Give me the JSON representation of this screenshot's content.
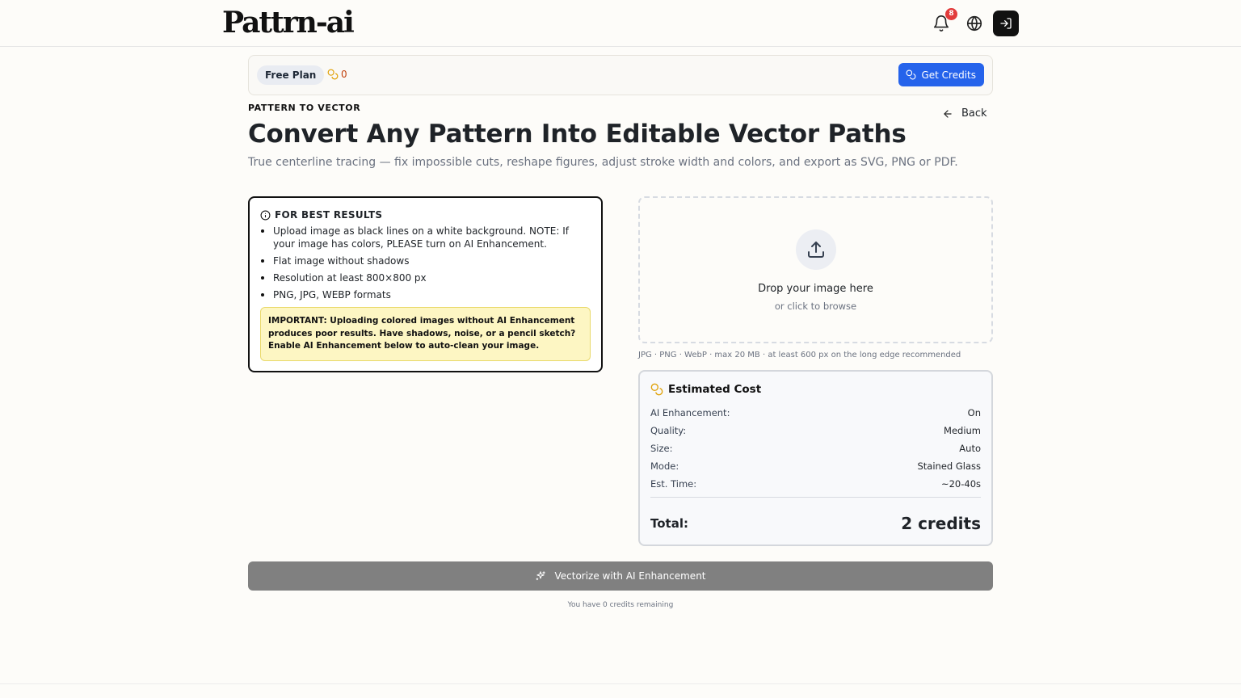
{
  "header": {
    "logo": "Pattrn-ai",
    "notifications_count": "8",
    "icons": [
      "bell-icon",
      "globe-icon",
      "login-icon"
    ]
  },
  "plan_bar": {
    "plan_label": "Free Plan",
    "credits": "0",
    "get_credits_label": "Get Credits"
  },
  "page": {
    "eyebrow": "PATTERN TO VECTOR",
    "back_label": "Back",
    "title": "Convert Any Pattern Into Editable Vector Paths",
    "subtitle": "True centerline tracing — fix impossible cuts, reshape figures, adjust stroke width and colors, and export as SVG, PNG or PDF."
  },
  "tips": {
    "heading": "FOR BEST RESULTS",
    "items": [
      "Upload image as black lines on a white background. NOTE: If your image has colors, PLEASE turn on AI Enhancement.",
      "Flat image without shadows",
      "Resolution at least 800×800 px",
      "PNG, JPG, WEBP formats"
    ],
    "warning": "IMPORTANT: Uploading colored images without AI Enhancement produces poor results. Have shadows, noise, or a pencil sketch? Enable AI Enhancement below to auto-clean your image."
  },
  "upload": {
    "title": "Drop your image here",
    "subtitle": "or click to browse",
    "formats": "JPG · PNG · WebP · max 20 MB · at least 600 px on the long edge recommended"
  },
  "cost": {
    "heading": "Estimated Cost",
    "rows": [
      {
        "label": "AI Enhancement:",
        "value": "On"
      },
      {
        "label": "Quality:",
        "value": "Medium"
      },
      {
        "label": "Size:",
        "value": "Auto"
      },
      {
        "label": "Mode:",
        "value": "Stained Glass"
      },
      {
        "label": "Est. Time:",
        "value": "~20-40s"
      }
    ],
    "total_label": "Total:",
    "total_value": "2 credits"
  },
  "action": {
    "button_label": "Vectorize with AI Enhancement",
    "remaining_text": "You have 0 credits remaining"
  },
  "colors": {
    "accent": "#2563eb",
    "badge": "#e23b3b",
    "warning_bg": "#fdf6c3",
    "disabled_button": "#808080"
  }
}
